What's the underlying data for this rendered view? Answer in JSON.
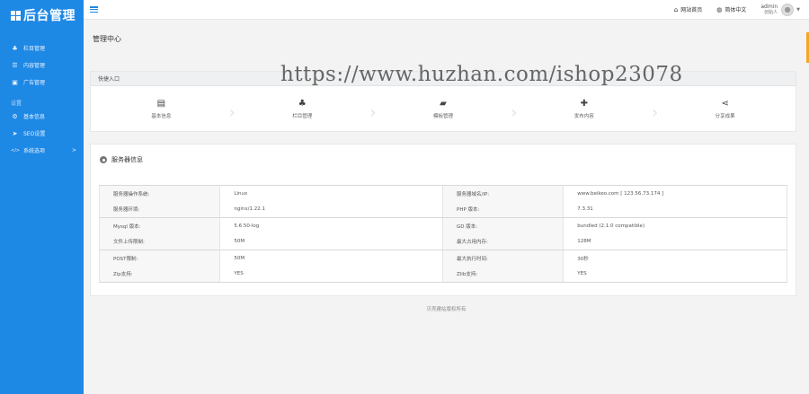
{
  "logo": {
    "title": "后台管理"
  },
  "sidebar": {
    "items": [
      {
        "icon": "sitemap-icon",
        "glyph": "♣",
        "label": "栏目管理"
      },
      {
        "icon": "list-icon",
        "glyph": "☰",
        "label": "内容管理"
      },
      {
        "icon": "image-icon",
        "glyph": "▣",
        "label": "广告管理"
      }
    ],
    "group_label": "设置",
    "settings": [
      {
        "icon": "gear-icon",
        "glyph": "⚙",
        "label": "基本信息"
      },
      {
        "icon": "send-icon",
        "glyph": "➤",
        "label": "SEO设置"
      },
      {
        "icon": "code-icon",
        "glyph": "</>",
        "label": "系统选项",
        "arrow": ">"
      }
    ]
  },
  "topbar": {
    "site_home": "网站首页",
    "language": "简体中文",
    "user_name": "admin",
    "user_role": "创始人"
  },
  "page": {
    "title": "管理中心"
  },
  "watermark": "https://www.huzhan.com/ishop23078",
  "quick": {
    "heading": "快捷入口",
    "items": [
      {
        "icon": "id-card-icon",
        "glyph": "🪪",
        "label": "基本信息"
      },
      {
        "icon": "sitemap-icon",
        "glyph": "♣",
        "label": "栏目管理"
      },
      {
        "icon": "folder-icon",
        "glyph": "📂",
        "label": "模板管理"
      },
      {
        "icon": "plus-icon",
        "glyph": "✚",
        "label": "发布内容"
      },
      {
        "icon": "share-icon",
        "glyph": "⋖",
        "label": "分享成果"
      }
    ]
  },
  "server": {
    "heading": "服务器信息",
    "rows": [
      [
        "服务器操作系统:",
        "Linux",
        "服务器域名/IP:",
        "www.beikeo.com [ 123.56.73.174 ]"
      ],
      [
        "服务器环境:",
        "nginx/1.22.1",
        "PHP 版本:",
        "7.3.31"
      ],
      [
        "Mysql 版本:",
        "5.6.50-log",
        "GD 版本:",
        "bundled (2.1.0 compatible)"
      ],
      [
        "文件上传限制:",
        "50M",
        "最大占用内存:",
        "128M"
      ],
      [
        "POST限制:",
        "50M",
        "最大执行时间:",
        "30秒"
      ],
      [
        "Zip支持:",
        "YES",
        "Zlib支持:",
        "YES"
      ]
    ]
  },
  "footer": {
    "text": "贝壳建站版权所有"
  },
  "colors": {
    "sidebar": "#1e88e5",
    "accent": "#f5a623"
  }
}
